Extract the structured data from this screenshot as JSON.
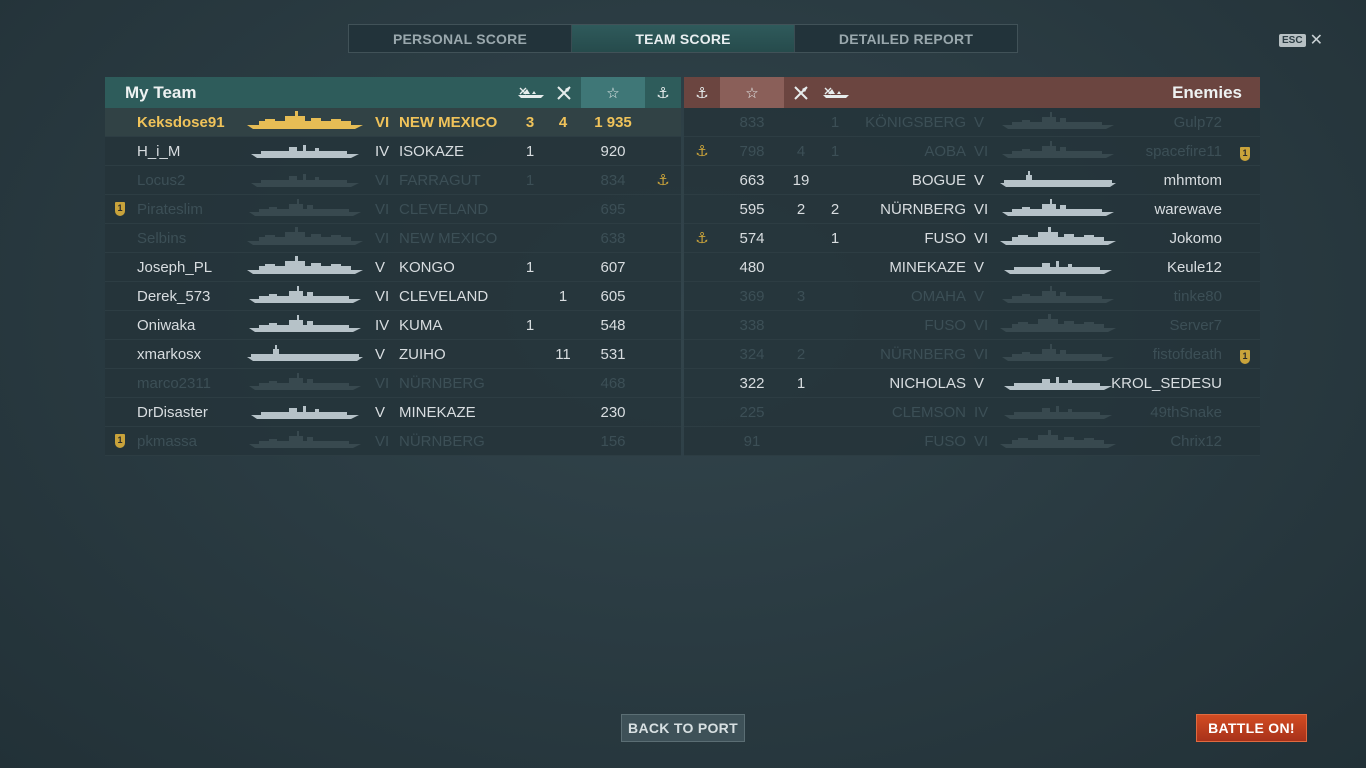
{
  "tabs": [
    {
      "label": "PERSONAL SCORE",
      "active": false
    },
    {
      "label": "TEAM SCORE",
      "active": true
    },
    {
      "label": "DETAILED REPORT",
      "active": false
    }
  ],
  "esc": {
    "key": "ESC",
    "close": "✕"
  },
  "my_team": {
    "title": "My Team",
    "header_icons": [
      "ships-destroyed-icon",
      "planes-destroyed-icon",
      "xp-star-icon",
      "anchor-icon"
    ],
    "star_glyph": "☆",
    "anchor_glyph": "⚓",
    "rows": [
      {
        "player": "Keksdose91",
        "tier": "VI",
        "ship": "NEW MEXICO",
        "kills": "3",
        "planes": "4",
        "xp": "1 935",
        "anchor": "",
        "badge": "",
        "state": "self",
        "ship_type": "battleship"
      },
      {
        "player": "H_i_M",
        "tier": "IV",
        "ship": "ISOKAZE",
        "kills": "1",
        "planes": "",
        "xp": "920",
        "anchor": "",
        "badge": "",
        "state": "alive",
        "ship_type": "destroyer"
      },
      {
        "player": "Locus2",
        "tier": "VI",
        "ship": "FARRAGUT",
        "kills": "1",
        "planes": "",
        "xp": "834",
        "anchor": "⚓",
        "badge": "",
        "state": "dead",
        "ship_type": "destroyer"
      },
      {
        "player": "Pirateslim",
        "tier": "VI",
        "ship": "CLEVELAND",
        "kills": "",
        "planes": "",
        "xp": "695",
        "anchor": "",
        "badge": "1",
        "state": "dead",
        "ship_type": "cruiser"
      },
      {
        "player": "Selbins",
        "tier": "VI",
        "ship": "NEW MEXICO",
        "kills": "",
        "planes": "",
        "xp": "638",
        "anchor": "",
        "badge": "",
        "state": "dead",
        "ship_type": "battleship"
      },
      {
        "player": "Joseph_PL",
        "tier": "V",
        "ship": "KONGO",
        "kills": "1",
        "planes": "",
        "xp": "607",
        "anchor": "",
        "badge": "",
        "state": "alive",
        "ship_type": "battleship"
      },
      {
        "player": "Derek_573",
        "tier": "VI",
        "ship": "CLEVELAND",
        "kills": "",
        "planes": "1",
        "xp": "605",
        "anchor": "",
        "badge": "",
        "state": "alive",
        "ship_type": "cruiser"
      },
      {
        "player": "Oniwaka",
        "tier": "IV",
        "ship": "KUMA",
        "kills": "1",
        "planes": "",
        "xp": "548",
        "anchor": "",
        "badge": "",
        "state": "alive",
        "ship_type": "cruiser"
      },
      {
        "player": "xmarkosx",
        "tier": "V",
        "ship": "ZUIHO",
        "kills": "",
        "planes": "11",
        "xp": "531",
        "anchor": "",
        "badge": "",
        "state": "alive",
        "ship_type": "carrier"
      },
      {
        "player": "marco2311",
        "tier": "VI",
        "ship": "NÜRNBERG",
        "kills": "",
        "planes": "",
        "xp": "468",
        "anchor": "",
        "badge": "",
        "state": "dead",
        "ship_type": "cruiser"
      },
      {
        "player": "DrDisaster",
        "tier": "V",
        "ship": "MINEKAZE",
        "kills": "",
        "planes": "",
        "xp": "230",
        "anchor": "",
        "badge": "",
        "state": "alive",
        "ship_type": "destroyer"
      },
      {
        "player": "pkmassa",
        "tier": "VI",
        "ship": "NÜRNBERG",
        "kills": "",
        "planes": "",
        "xp": "156",
        "anchor": "",
        "badge": "1",
        "state": "dead",
        "ship_type": "cruiser"
      }
    ]
  },
  "enemies": {
    "title": "Enemies",
    "header_icons": [
      "anchor-icon",
      "xp-star-icon",
      "planes-destroyed-icon",
      "ships-destroyed-icon"
    ],
    "star_glyph": "☆",
    "anchor_glyph": "⚓",
    "rows": [
      {
        "anchor": "",
        "xp": "833",
        "planes": "",
        "kills": "1",
        "ship": "KÖNIGSBERG",
        "tier": "V",
        "player": "Gulp72",
        "badge": "",
        "state": "dead",
        "ship_type": "cruiser"
      },
      {
        "anchor": "⚓",
        "xp": "798",
        "planes": "4",
        "kills": "1",
        "ship": "AOBA",
        "tier": "VI",
        "player": "spacefire11",
        "badge": "1",
        "state": "dead",
        "ship_type": "cruiser"
      },
      {
        "anchor": "",
        "xp": "663",
        "planes": "19",
        "kills": "",
        "ship": "BOGUE",
        "tier": "V",
        "player": "mhmtom",
        "badge": "",
        "state": "alive",
        "ship_type": "carrier"
      },
      {
        "anchor": "",
        "xp": "595",
        "planes": "2",
        "kills": "2",
        "ship": "NÜRNBERG",
        "tier": "VI",
        "player": "warewave",
        "badge": "",
        "state": "alive",
        "ship_type": "cruiser"
      },
      {
        "anchor": "⚓",
        "xp": "574",
        "planes": "",
        "kills": "1",
        "ship": "FUSO",
        "tier": "VI",
        "player": "Jokomo",
        "badge": "",
        "state": "alive",
        "ship_type": "battleship"
      },
      {
        "anchor": "",
        "xp": "480",
        "planes": "",
        "kills": "",
        "ship": "MINEKAZE",
        "tier": "V",
        "player": "Keule12",
        "badge": "",
        "state": "alive",
        "ship_type": "destroyer"
      },
      {
        "anchor": "",
        "xp": "369",
        "planes": "3",
        "kills": "",
        "ship": "OMAHA",
        "tier": "V",
        "player": "tinke80",
        "badge": "",
        "state": "dead",
        "ship_type": "cruiser"
      },
      {
        "anchor": "",
        "xp": "338",
        "planes": "",
        "kills": "",
        "ship": "FUSO",
        "tier": "VI",
        "player": "Server7",
        "badge": "",
        "state": "dead",
        "ship_type": "battleship"
      },
      {
        "anchor": "",
        "xp": "324",
        "planes": "2",
        "kills": "",
        "ship": "NÜRNBERG",
        "tier": "VI",
        "player": "fistofdeath",
        "badge": "1",
        "state": "dead",
        "ship_type": "cruiser"
      },
      {
        "anchor": "",
        "xp": "322",
        "planes": "1",
        "kills": "",
        "ship": "NICHOLAS",
        "tier": "V",
        "player": "KROL_SEDESU",
        "badge": "",
        "state": "alive",
        "ship_type": "destroyer"
      },
      {
        "anchor": "",
        "xp": "225",
        "planes": "",
        "kills": "",
        "ship": "CLEMSON",
        "tier": "IV",
        "player": "49thSnake",
        "badge": "",
        "state": "dead",
        "ship_type": "destroyer"
      },
      {
        "anchor": "",
        "xp": "91",
        "planes": "",
        "kills": "",
        "ship": "FUSO",
        "tier": "VI",
        "player": "Chrix12",
        "badge": "",
        "state": "dead",
        "ship_type": "battleship"
      }
    ]
  },
  "buttons": {
    "back": "BACK TO PORT",
    "battle": "BATTLE ON!"
  },
  "colors": {
    "self": "#f0c35a",
    "ally_header": "#2e5c5b",
    "enemy_header": "#6b4540",
    "battle_button": "#c0401e"
  }
}
